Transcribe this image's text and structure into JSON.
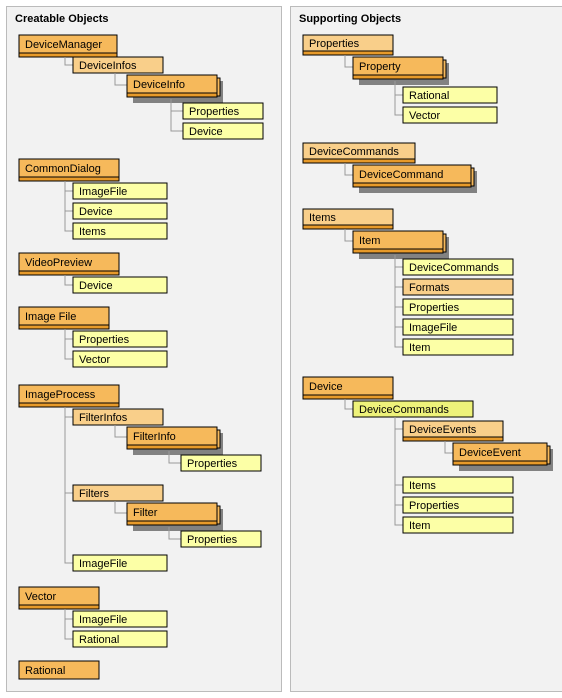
{
  "left": {
    "title": "Creatable Objects",
    "deviceManager": "DeviceManager",
    "deviceInfos": "DeviceInfos",
    "deviceInfo": "DeviceInfo",
    "dm_properties": "Properties",
    "dm_device": "Device",
    "commonDialog": "CommonDialog",
    "cd_imageFile": "ImageFile",
    "cd_device": "Device",
    "cd_items": "Items",
    "videoPreview": "VideoPreview",
    "vp_device": "Device",
    "imageFile": "Image File",
    "if_properties": "Properties",
    "if_vector": "Vector",
    "imageProcess": "ImageProcess",
    "filterInfos": "FilterInfos",
    "filterInfo": "FilterInfo",
    "fi_properties": "Properties",
    "filters": "Filters",
    "filter": "Filter",
    "f_properties": "Properties",
    "ip_imageFile": "ImageFile",
    "vector": "Vector",
    "v_imageFile": "ImageFile",
    "v_rational": "Rational",
    "rational": "Rational"
  },
  "right": {
    "title": "Supporting Objects",
    "properties": "Properties",
    "property": "Property",
    "p_rational": "Rational",
    "p_vector": "Vector",
    "deviceCommands": "DeviceCommands",
    "deviceCommand": "DeviceCommand",
    "items": "Items",
    "item": "Item",
    "it_deviceCommands": "DeviceCommands",
    "it_formats": "Formats",
    "it_properties": "Properties",
    "it_imageFile": "ImageFile",
    "it_item": "Item",
    "device": "Device",
    "dv_deviceCommands": "DeviceCommands",
    "deviceEvents": "DeviceEvents",
    "deviceEvent": "DeviceEvent",
    "dv_items": "Items",
    "dv_properties": "Properties",
    "dv_item": "Item"
  }
}
